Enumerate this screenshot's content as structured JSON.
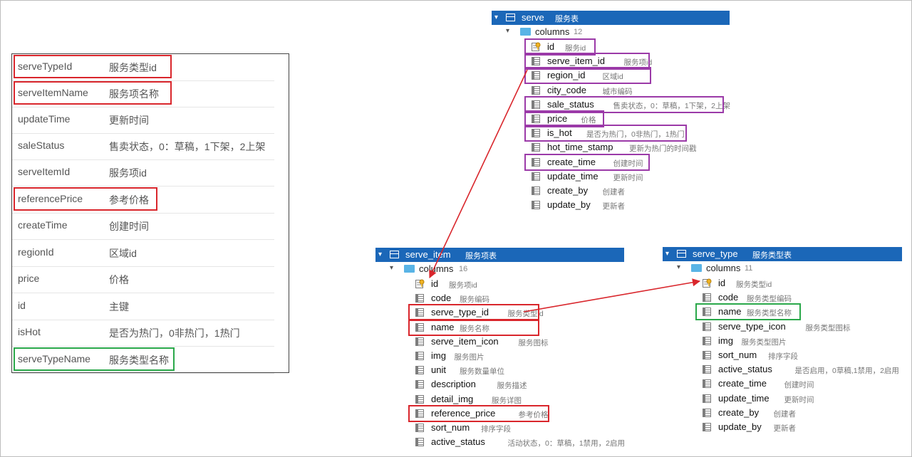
{
  "fields": [
    {
      "name": "serveTypeId",
      "desc": "服务类型id",
      "highlight": "red"
    },
    {
      "name": "serveItemName",
      "desc": "服务项名称",
      "highlight": "red"
    },
    {
      "name": "updateTime",
      "desc": "更新时间",
      "highlight": ""
    },
    {
      "name": "saleStatus",
      "desc": "售卖状态，0：草稿，1下架，2上架",
      "highlight": ""
    },
    {
      "name": "serveItemId",
      "desc": "服务项id",
      "highlight": ""
    },
    {
      "name": "referencePrice",
      "desc": "参考价格",
      "highlight": "red"
    },
    {
      "name": "createTime",
      "desc": "创建时间",
      "highlight": ""
    },
    {
      "name": "regionId",
      "desc": "区域id",
      "highlight": ""
    },
    {
      "name": "price",
      "desc": "价格",
      "highlight": ""
    },
    {
      "name": "id",
      "desc": "主键",
      "highlight": ""
    },
    {
      "name": "isHot",
      "desc": "是否为热门，0非热门，1热门",
      "highlight": ""
    },
    {
      "name": "serveTypeName",
      "desc": "服务类型名称",
      "highlight": "green"
    }
  ],
  "tables": {
    "serve": {
      "name": "serve",
      "comment": "服务表",
      "columns_label": "columns",
      "count": "12",
      "columns": [
        {
          "name": "id",
          "comment": "服务id",
          "key": true
        },
        {
          "name": "serve_item_id",
          "comment": "服务项id",
          "key": false
        },
        {
          "name": "region_id",
          "comment": "区域id",
          "key": false
        },
        {
          "name": "city_code",
          "comment": "城市编码",
          "key": false
        },
        {
          "name": "sale_status",
          "comment": "售卖状态，0：草稿，1下架，2上架",
          "key": false
        },
        {
          "name": "price",
          "comment": "价格",
          "key": false
        },
        {
          "name": "is_hot",
          "comment": "是否为热门，0非热门，1热门",
          "key": false
        },
        {
          "name": "hot_time_stamp",
          "comment": "更新为热门的时间戳",
          "key": false
        },
        {
          "name": "create_time",
          "comment": "创建时间",
          "key": false
        },
        {
          "name": "update_time",
          "comment": "更新时间",
          "key": false
        },
        {
          "name": "create_by",
          "comment": "创建者",
          "key": false
        },
        {
          "name": "update_by",
          "comment": "更新者",
          "key": false
        }
      ]
    },
    "serve_item": {
      "name": "serve_item",
      "comment": "服务项表",
      "columns_label": "columns",
      "count": "16",
      "columns": [
        {
          "name": "id",
          "comment": "服务项id",
          "key": true
        },
        {
          "name": "code",
          "comment": "服务编码",
          "key": false
        },
        {
          "name": "serve_type_id",
          "comment": "服务类型id",
          "key": false
        },
        {
          "name": "name",
          "comment": "服务名称",
          "key": false
        },
        {
          "name": "serve_item_icon",
          "comment": "服务图标",
          "key": false
        },
        {
          "name": "img",
          "comment": "服务图片",
          "key": false
        },
        {
          "name": "unit",
          "comment": "服务数量单位",
          "key": false
        },
        {
          "name": "description",
          "comment": "服务描述",
          "key": false
        },
        {
          "name": "detail_img",
          "comment": "服务详图",
          "key": false
        },
        {
          "name": "reference_price",
          "comment": "参考价格",
          "key": false
        },
        {
          "name": "sort_num",
          "comment": "排序字段",
          "key": false
        },
        {
          "name": "active_status",
          "comment": "活动状态，0：草稿，1禁用，2启用",
          "key": false
        }
      ]
    },
    "serve_type": {
      "name": "serve_type",
      "comment": "服务类型表",
      "columns_label": "columns",
      "count": "11",
      "columns": [
        {
          "name": "id",
          "comment": "服务类型id",
          "key": true
        },
        {
          "name": "code",
          "comment": "服务类型编码",
          "key": false
        },
        {
          "name": "name",
          "comment": "服务类型名称",
          "key": false
        },
        {
          "name": "serve_type_icon",
          "comment": "服务类型图标",
          "key": false
        },
        {
          "name": "img",
          "comment": "服务类型图片",
          "key": false
        },
        {
          "name": "sort_num",
          "comment": "排序字段",
          "key": false
        },
        {
          "name": "active_status",
          "comment": "是否启用，0草稿,1禁用，2启用",
          "key": false
        },
        {
          "name": "create_time",
          "comment": "创建时间",
          "key": false
        },
        {
          "name": "update_time",
          "comment": "更新时间",
          "key": false
        },
        {
          "name": "create_by",
          "comment": "创建者",
          "key": false
        },
        {
          "name": "update_by",
          "comment": "更新者",
          "key": false
        }
      ]
    }
  },
  "colors": {
    "red": "#d9262c",
    "green": "#2aa84a",
    "purple": "#9b3aa8",
    "header": "#1b67b8"
  }
}
